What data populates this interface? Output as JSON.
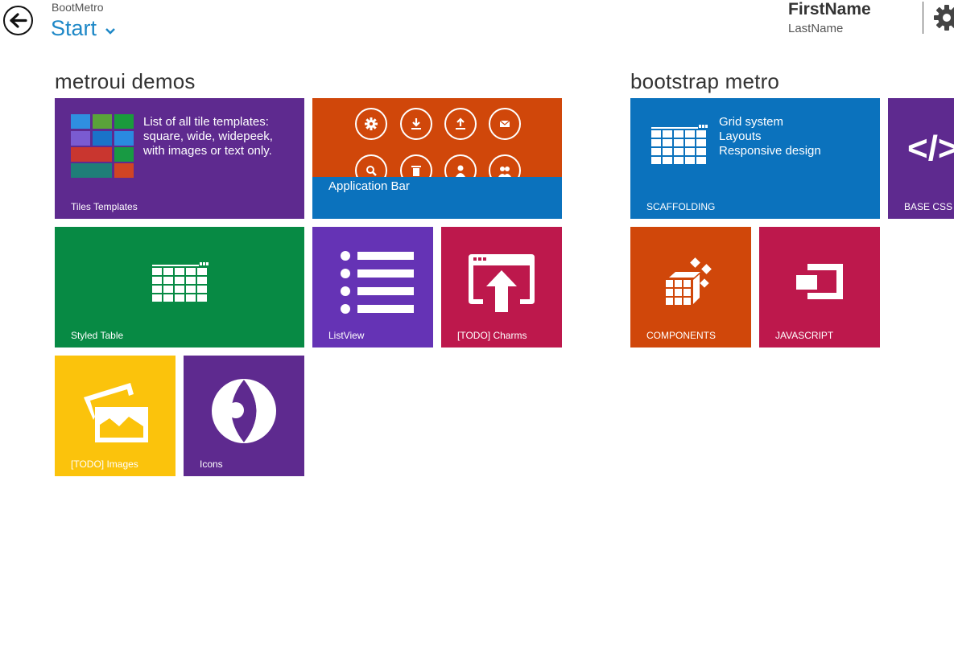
{
  "header": {
    "app_name": "BootMetro",
    "page_title": "Start",
    "user_first_name": "FirstName",
    "user_last_name": "LastName"
  },
  "groups": [
    {
      "title": "metroui demos",
      "tiles": [
        {
          "label": "Tiles Templates",
          "text": "List of all tile templates: square, wide, widepeek, with images or text only.",
          "color": "#5e2a8f",
          "icon": "tile-grid-icon"
        },
        {
          "label": "Application Bar",
          "color": "#d0470a",
          "icon": "appbar-icons"
        },
        {
          "label": "Styled Table",
          "color": "#078a44",
          "icon": "table-icon"
        },
        {
          "label": "ListView",
          "color": "#6533b5",
          "icon": "list-icon"
        },
        {
          "label": "[TODO] Charms",
          "color": "#bd184c",
          "icon": "charms-icon"
        },
        {
          "label": "[TODO] Images",
          "color": "#fbc30c",
          "icon": "images-icon"
        },
        {
          "label": "Icons",
          "color": "#5e2a8f",
          "icon": "eye-icon"
        }
      ]
    },
    {
      "title": "bootstrap metro",
      "tiles": [
        {
          "label": "SCAFFOLDING",
          "lines": [
            "Grid system",
            "Layouts",
            "Responsive design"
          ],
          "color": "#0b72bd",
          "icon": "table-icon"
        },
        {
          "label": "BASE CSS",
          "glyph": "</>",
          "color": "#5e2a8f",
          "icon": "code-icon"
        },
        {
          "label": "COMPONENTS",
          "color": "#d0470a",
          "icon": "cubes-icon"
        },
        {
          "label": "JAVASCRIPT",
          "color": "#bd184c",
          "icon": "window-icon"
        }
      ]
    }
  ]
}
